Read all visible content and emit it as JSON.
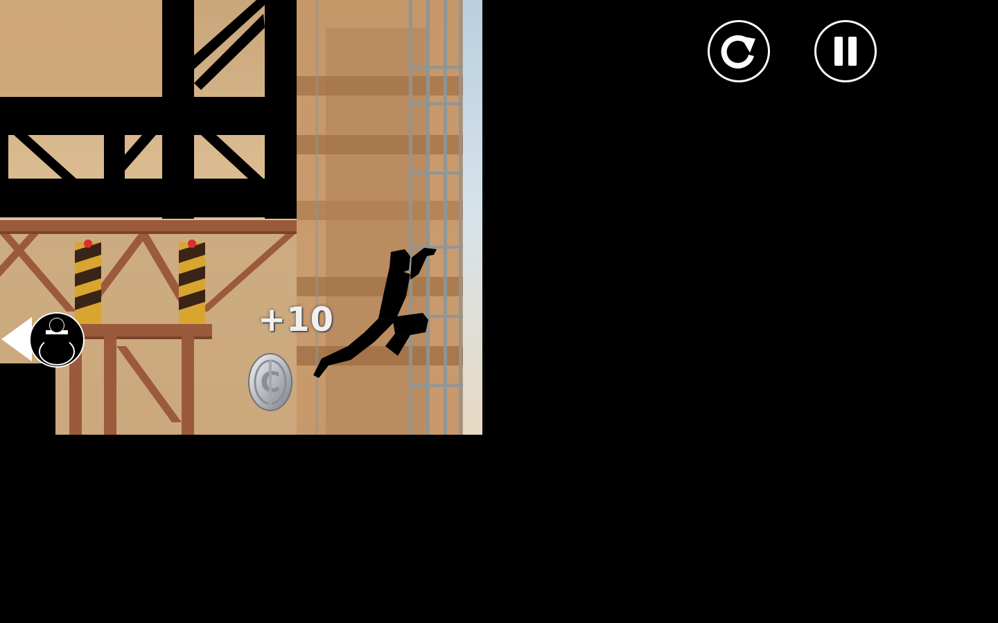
{
  "hud": {
    "restart_icon": "restart-icon",
    "pause_icon": "pause-icon"
  },
  "popup": {
    "score_gain": "+10"
  },
  "pickup": {
    "coin_icon": "coin-icon",
    "coin_glyph": "C"
  },
  "characters": {
    "player_icon": "runner-silhouette",
    "chaser_icon": "chaser-indicator-icon"
  },
  "colors": {
    "hud_stroke": "#ffffff",
    "background": "#000000",
    "sky": "#c9a57a",
    "girder": "#9b5a3c",
    "hazard_yellow": "#d9a531",
    "warning_light": "#d9302a",
    "coin_silver": "#c9ccd0"
  }
}
